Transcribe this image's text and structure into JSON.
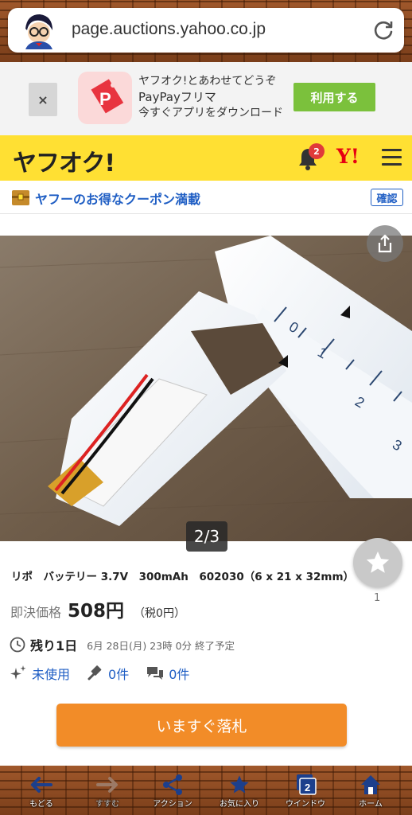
{
  "browser": {
    "url": "page.auctions.yahoo.co.jp"
  },
  "banner": {
    "close_label": "×",
    "line1": "ヤフオク!とあわせてどうぞ",
    "line2": "PayPayフリマ",
    "line3": "今すぐアプリをダウンロード",
    "use_button": "利用する"
  },
  "header": {
    "logo": "ヤフオク!",
    "notification_count": "2",
    "yahoo_logo": "Y!"
  },
  "coupon": {
    "text": "ヤフーのお得なクーポン満載",
    "confirm_label": "確認"
  },
  "gallery": {
    "counter": "2/3"
  },
  "item": {
    "title": "リポ　バッテリー 3.7V　300mAh　602030（6 x 21 x 32mm）",
    "price_label": "即決価格",
    "price": "508円",
    "tax": "（税0円）",
    "time_left": "残り1日",
    "end_time": "6月 28日(月) 23時 0分 終了予定",
    "condition": "未使用",
    "bids": "0件",
    "questions": "0件",
    "watch_count": "1",
    "buy_button": "いますぐ落札"
  },
  "bottom_nav": {
    "back": "もどる",
    "forward": "すすむ",
    "action": "アクション",
    "favorites": "お気に入り",
    "windows": "ウインドウ",
    "windows_count": "2",
    "home": "ホーム"
  },
  "colors": {
    "header_yellow": "#ffe033",
    "link_blue": "#1f5ec4",
    "buy_orange": "#f28c28",
    "use_green": "#7bc13c"
  }
}
